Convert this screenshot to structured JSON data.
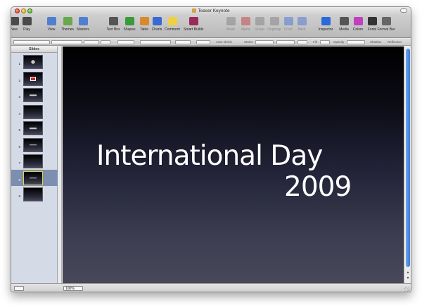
{
  "window": {
    "title": "Teaser Keynote"
  },
  "toolbar": {
    "items": [
      {
        "label": "New",
        "icon": "new-icon",
        "color": "#4a4a4a",
        "enabled": true
      },
      {
        "label": "Play",
        "icon": "play-icon",
        "color": "#4a4a4a",
        "enabled": true
      },
      {
        "label": "View",
        "icon": "view-icon",
        "color": "#4f7fd1",
        "enabled": true
      },
      {
        "label": "Themes",
        "icon": "themes-icon",
        "color": "#6aa84f",
        "enabled": true
      },
      {
        "label": "Masters",
        "icon": "masters-icon",
        "color": "#4f7fd1",
        "enabled": true
      },
      {
        "label": "Text Box",
        "icon": "text-box-icon",
        "color": "#555555",
        "enabled": true
      },
      {
        "label": "Shapes",
        "icon": "shapes-icon",
        "color": "#3a9a3a",
        "enabled": true
      },
      {
        "label": "Table",
        "icon": "table-icon",
        "color": "#d88a2a",
        "enabled": true
      },
      {
        "label": "Charts",
        "icon": "charts-icon",
        "color": "#3a6ad0",
        "enabled": true
      },
      {
        "label": "Comment",
        "icon": "comment-icon",
        "color": "#f0d040",
        "enabled": true
      },
      {
        "label": "Smart Builds",
        "icon": "smart-builds-icon",
        "color": "#9a2a5a",
        "enabled": true
      },
      {
        "label": "Mask",
        "icon": "mask-icon",
        "color": "#777777",
        "enabled": false
      },
      {
        "label": "Alpha",
        "icon": "alpha-icon",
        "color": "#c03030",
        "enabled": false
      },
      {
        "label": "Group",
        "icon": "group-icon",
        "color": "#777777",
        "enabled": false
      },
      {
        "label": "Ungroup",
        "icon": "ungroup-icon",
        "color": "#777777",
        "enabled": false
      },
      {
        "label": "Front",
        "icon": "front-icon",
        "color": "#3a6ad0",
        "enabled": false
      },
      {
        "label": "Back",
        "icon": "back-icon",
        "color": "#3a6ad0",
        "enabled": false
      },
      {
        "label": "Inspector",
        "icon": "inspector-icon",
        "color": "#2a6ad8",
        "enabled": true
      },
      {
        "label": "Media",
        "icon": "media-icon",
        "color": "#555555",
        "enabled": true
      },
      {
        "label": "Colors",
        "icon": "colors-icon",
        "color": "#c040c0",
        "enabled": true
      },
      {
        "label": "Fonts",
        "icon": "fonts-icon",
        "color": "#333333",
        "enabled": true
      },
      {
        "label": "Format Bar",
        "icon": "format-bar-icon",
        "color": "#666666",
        "enabled": true
      }
    ]
  },
  "formatbar": {
    "auto_shrink": "Auto-shrink",
    "stroke": "Stroke",
    "fill": "Fill",
    "opacity": "Opacity",
    "shadow": "Shadow",
    "reflection": "Reflection"
  },
  "navigator": {
    "header": "Slides",
    "slides": [
      {
        "num": "1",
        "mark": "circle",
        "selected": false
      },
      {
        "num": "2",
        "mark": "card",
        "selected": false
      },
      {
        "num": "3",
        "mark": "text",
        "selected": false
      },
      {
        "num": "4",
        "mark": "none",
        "selected": false
      },
      {
        "num": "5",
        "mark": "text",
        "selected": false
      },
      {
        "num": "6",
        "mark": "text",
        "selected": false
      },
      {
        "num": "7",
        "mark": "none",
        "selected": false
      },
      {
        "num": "8",
        "mark": "text",
        "selected": true
      },
      {
        "num": "9",
        "mark": "none",
        "selected": false
      }
    ]
  },
  "slide": {
    "title": "International Day",
    "year": "2009"
  },
  "bottombar": {
    "zoom": "100%"
  }
}
